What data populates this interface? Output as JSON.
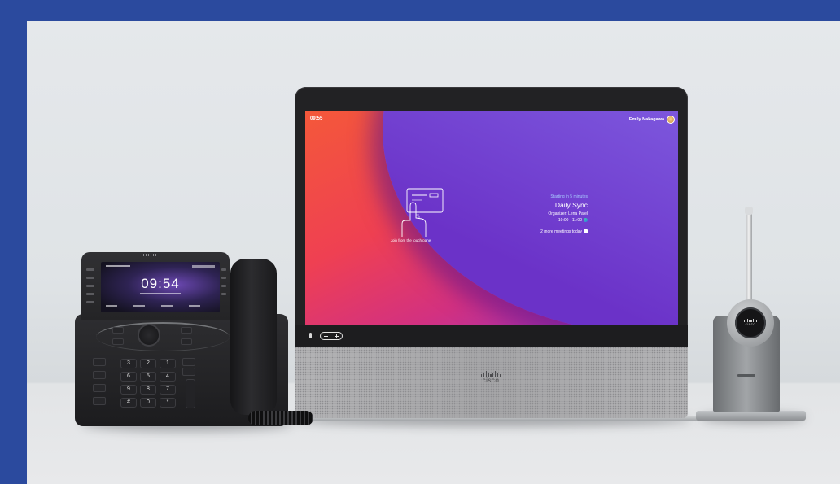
{
  "colors": {
    "frame_blue": "#2b4a9e",
    "screen_orange": "#f4583a",
    "screen_purple": "#7f5ce0",
    "device_black": "#222224",
    "speaker_gray": "#a8a8aa"
  },
  "desk_device": {
    "status_bar": {
      "clock": "09:55",
      "user_name": "Emily Nakagawa"
    },
    "touch_hint": "Join from the touch panel",
    "meeting": {
      "status": "Starting in 5 minutes",
      "title": "Daily Sync",
      "organizer": "Organizer: Lena Patel",
      "time": "10:00 - 11:00",
      "more": "2 more meetings today"
    },
    "speaker_logo": "cisco"
  },
  "desk_phone": {
    "clock": "09:54",
    "keypad": [
      [
        "3",
        "2",
        "1"
      ],
      [
        "6",
        "5",
        "4"
      ],
      [
        "9",
        "8",
        "7"
      ],
      [
        "#",
        "0",
        "*"
      ]
    ]
  },
  "headset": {
    "logo": "cisco"
  },
  "icons": [
    "touch-panel-icon",
    "webex-icon",
    "calendar-icon",
    "avatar",
    "mic-icon"
  ]
}
